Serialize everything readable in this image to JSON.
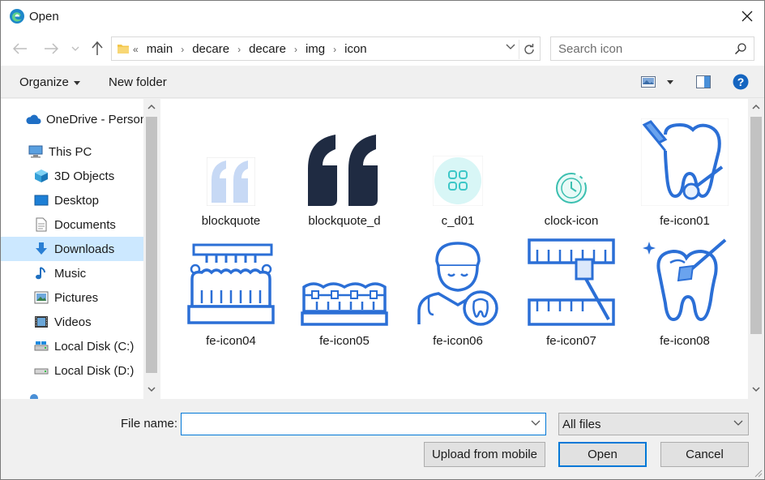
{
  "window": {
    "title": "Open",
    "close_icon": "close-icon"
  },
  "nav": {
    "breadcrumbs": [
      "main",
      "decare",
      "decare",
      "img",
      "icon"
    ],
    "breadcrumb_overflow": "«",
    "search_placeholder": "Search icon"
  },
  "toolbar": {
    "organize_label": "Organize",
    "new_folder_label": "New folder"
  },
  "tree": [
    {
      "label": "OneDrive - Personal",
      "icon": "cloud-icon",
      "selected": false
    },
    {
      "label": "This PC",
      "icon": "computer-icon",
      "selected": false
    },
    {
      "label": "3D Objects",
      "icon": "cube-icon",
      "selected": false
    },
    {
      "label": "Desktop",
      "icon": "desktop-icon",
      "selected": false
    },
    {
      "label": "Documents",
      "icon": "document-icon",
      "selected": false
    },
    {
      "label": "Downloads",
      "icon": "download-icon",
      "selected": true
    },
    {
      "label": "Music",
      "icon": "music-icon",
      "selected": false
    },
    {
      "label": "Pictures",
      "icon": "pictures-icon",
      "selected": false
    },
    {
      "label": "Videos",
      "icon": "videos-icon",
      "selected": false
    },
    {
      "label": "Local Disk (C:)",
      "icon": "drive-icon",
      "selected": false
    },
    {
      "label": "Local Disk (D:)",
      "icon": "drive-icon",
      "selected": false
    }
  ],
  "files": [
    {
      "name": "blockquote",
      "thumbnail": "light-quote-icon"
    },
    {
      "name": "blockquote_d",
      "thumbnail": "dark-quote-icon"
    },
    {
      "name": "c_d01",
      "thumbnail": "grid-circle-icon"
    },
    {
      "name": "clock-icon",
      "thumbnail": "clock-icon"
    },
    {
      "name": "fe-icon01",
      "thumbnail": "tooth-probe-icon"
    },
    {
      "name": "fe-icon04",
      "thumbnail": "teeth-brush-icon"
    },
    {
      "name": "fe-icon05",
      "thumbnail": "braces-icon"
    },
    {
      "name": "fe-icon06",
      "thumbnail": "dentist-icon"
    },
    {
      "name": "fe-icon07",
      "thumbnail": "teeth-mirror-icon"
    },
    {
      "name": "fe-icon08",
      "thumbnail": "tooth-clean-icon"
    }
  ],
  "bottom": {
    "file_name_label": "File name:",
    "file_name_value": "",
    "filter_value": "All files",
    "upload_label": "Upload from mobile",
    "open_label": "Open",
    "cancel_label": "Cancel"
  },
  "colors": {
    "accent": "#0078d7",
    "icon_blue": "#2b6fd6",
    "selected_bg": "#cce8ff"
  }
}
